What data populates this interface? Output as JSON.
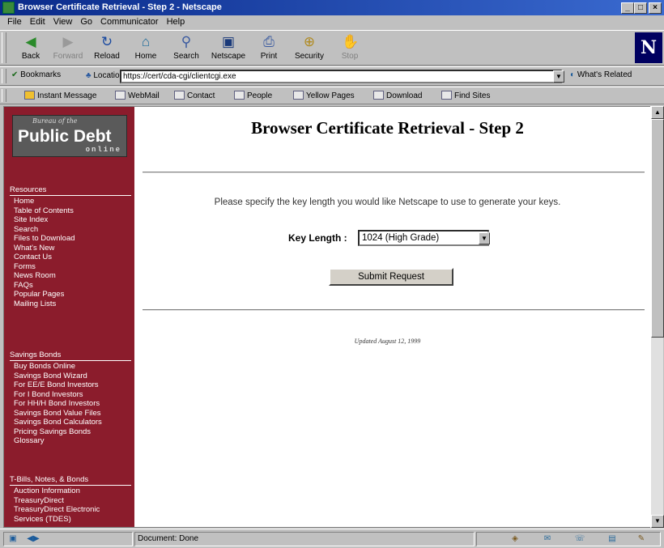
{
  "window": {
    "title": "Browser Certificate Retrieval - Step 2 - Netscape"
  },
  "menu": [
    "File",
    "Edit",
    "View",
    "Go",
    "Communicator",
    "Help"
  ],
  "navbar": [
    {
      "label": "Back",
      "icon": "back-arrow-icon",
      "enabled": true
    },
    {
      "label": "Forward",
      "icon": "forward-arrow-icon",
      "enabled": false
    },
    {
      "label": "Reload",
      "icon": "reload-icon",
      "enabled": true
    },
    {
      "label": "Home",
      "icon": "home-icon",
      "enabled": true
    },
    {
      "label": "Search",
      "icon": "search-icon",
      "enabled": true
    },
    {
      "label": "Netscape",
      "icon": "netscape-icon",
      "enabled": true
    },
    {
      "label": "Print",
      "icon": "print-icon",
      "enabled": true
    },
    {
      "label": "Security",
      "icon": "security-lock-icon",
      "enabled": true
    },
    {
      "label": "Stop",
      "icon": "stop-icon",
      "enabled": false
    }
  ],
  "location": {
    "bookmarks_label": "Bookmarks",
    "location_label": "Location:",
    "url": "https://cert/cda-cgi/clientcgi.exe",
    "related_label": "What's Related"
  },
  "personal_toolbar": [
    "Instant Message",
    "WebMail",
    "Contact",
    "People",
    "Yellow Pages",
    "Download",
    "Find Sites"
  ],
  "sidebar": {
    "logo": {
      "line1": "Bureau of the",
      "line2": "Public Debt",
      "line3": "online"
    },
    "sections": [
      {
        "heading": "Resources",
        "items": [
          "Home",
          "Table of Contents",
          "Site Index",
          "Search",
          "Files to Download",
          "What's New",
          "Contact Us",
          "Forms",
          "News Room",
          "FAQs",
          "Popular Pages",
          "Mailing Lists"
        ]
      },
      {
        "heading": "Savings Bonds",
        "items": [
          "Buy Bonds Online",
          "Savings Bond Wizard",
          "For EE/E Bond Investors",
          "For I Bond Investors",
          "For HH/H Bond Investors",
          "Savings Bond Value Files",
          "Savings Bond Calculators",
          "Pricing Savings Bonds",
          "Glossary"
        ]
      },
      {
        "heading": "T-Bills, Notes, & Bonds",
        "items": [
          "Auction Information",
          "TreasuryDirect",
          "TreasuryDirect Electronic",
          "Services (TDES)"
        ]
      }
    ]
  },
  "main": {
    "heading": "Browser Certificate Retrieval - Step 2",
    "instruction": "Please specify the key length you would like Netscape to use to generate your keys.",
    "key_length_label": "Key Length :",
    "key_length_value": "1024 (High Grade)",
    "submit_label": "Submit Request",
    "updated": "Updated August 12, 1999"
  },
  "status": {
    "text": "Document: Done"
  },
  "colors": {
    "sidebar_bg": "#8b1c2c",
    "titlebar": "#0a2a8a"
  }
}
